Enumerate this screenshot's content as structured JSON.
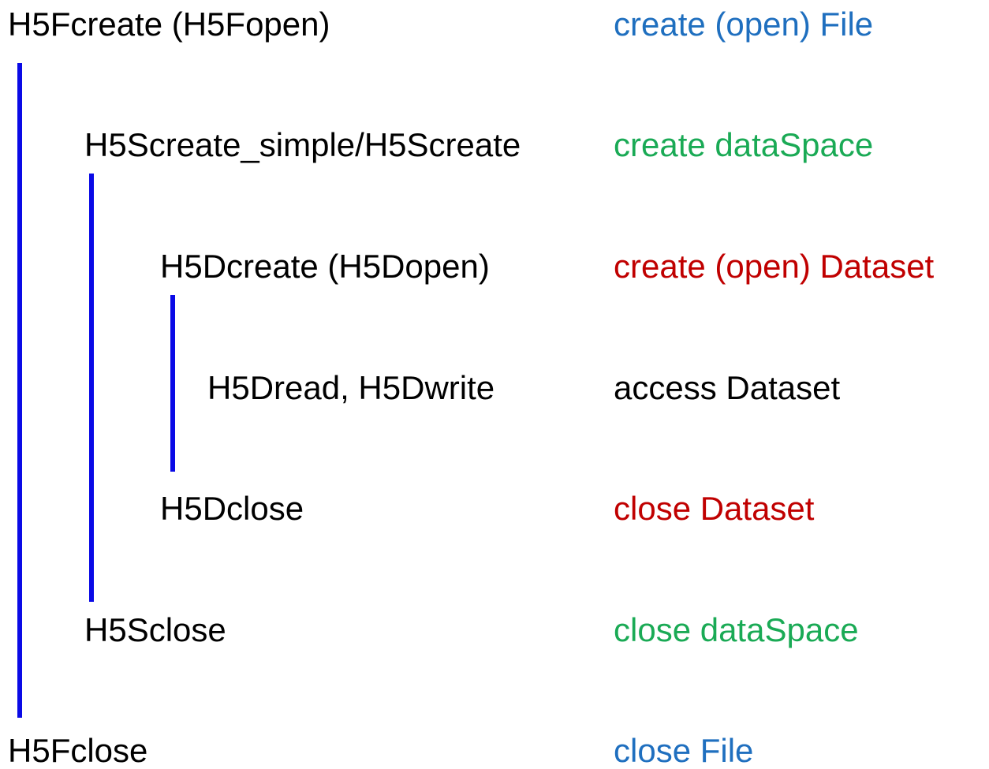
{
  "calls": {
    "file_open": "H5Fcreate (H5Fopen)",
    "space_create": "H5Screate_simple/H5Screate",
    "dataset_open": "H5Dcreate (H5Dopen)",
    "dataset_access": "H5Dread, H5Dwrite",
    "dataset_close": "H5Dclose",
    "space_close": "H5Sclose",
    "file_close": "H5Fclose"
  },
  "descriptions": {
    "file_open": "create (open) File",
    "space_create": "create dataSpace",
    "dataset_open": "create (open) Dataset",
    "dataset_access": "access Dataset",
    "dataset_close": "close Dataset",
    "space_close": "close dataSpace",
    "file_close": "close File"
  },
  "colors": {
    "file": "#1f6fbf",
    "dataspace": "#1aaa55",
    "dataset": "#c00000",
    "access": "#000000",
    "bracket": "#0a0ae6"
  }
}
